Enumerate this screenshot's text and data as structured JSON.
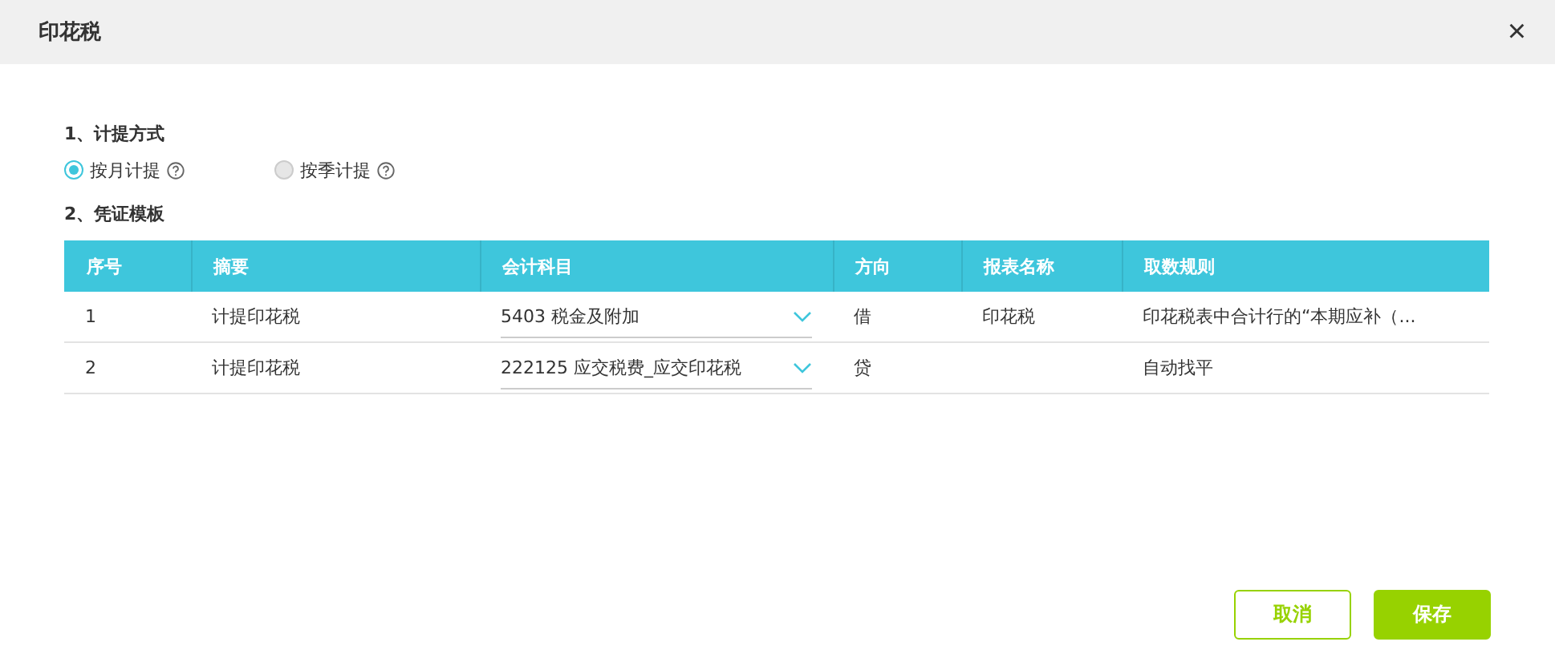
{
  "dialog": {
    "title": "印花税",
    "close": "×"
  },
  "section_1": {
    "title": "1、计提方式",
    "options": [
      {
        "label": "按月计提",
        "selected": true
      },
      {
        "label": "按季计提",
        "selected": false
      }
    ]
  },
  "section_2": {
    "title": "2、凭证模板"
  },
  "table": {
    "columns": [
      "序号",
      "摘要",
      "会计科目",
      "方向",
      "报表名称",
      "取数规则"
    ],
    "rows": [
      {
        "index": "1",
        "summary": "计提印花税",
        "account": "5403  税金及附加",
        "direction": "借",
        "report": "印花税",
        "rule": "印花税表中合计行的“本期应补（..."
      },
      {
        "index": "2",
        "summary": "计提印花税",
        "account": "222125  应交税费_应交印花税",
        "direction": "贷",
        "rule": "自动找平"
      }
    ]
  },
  "buttons": {
    "cancel": "取消",
    "save": "保存"
  }
}
